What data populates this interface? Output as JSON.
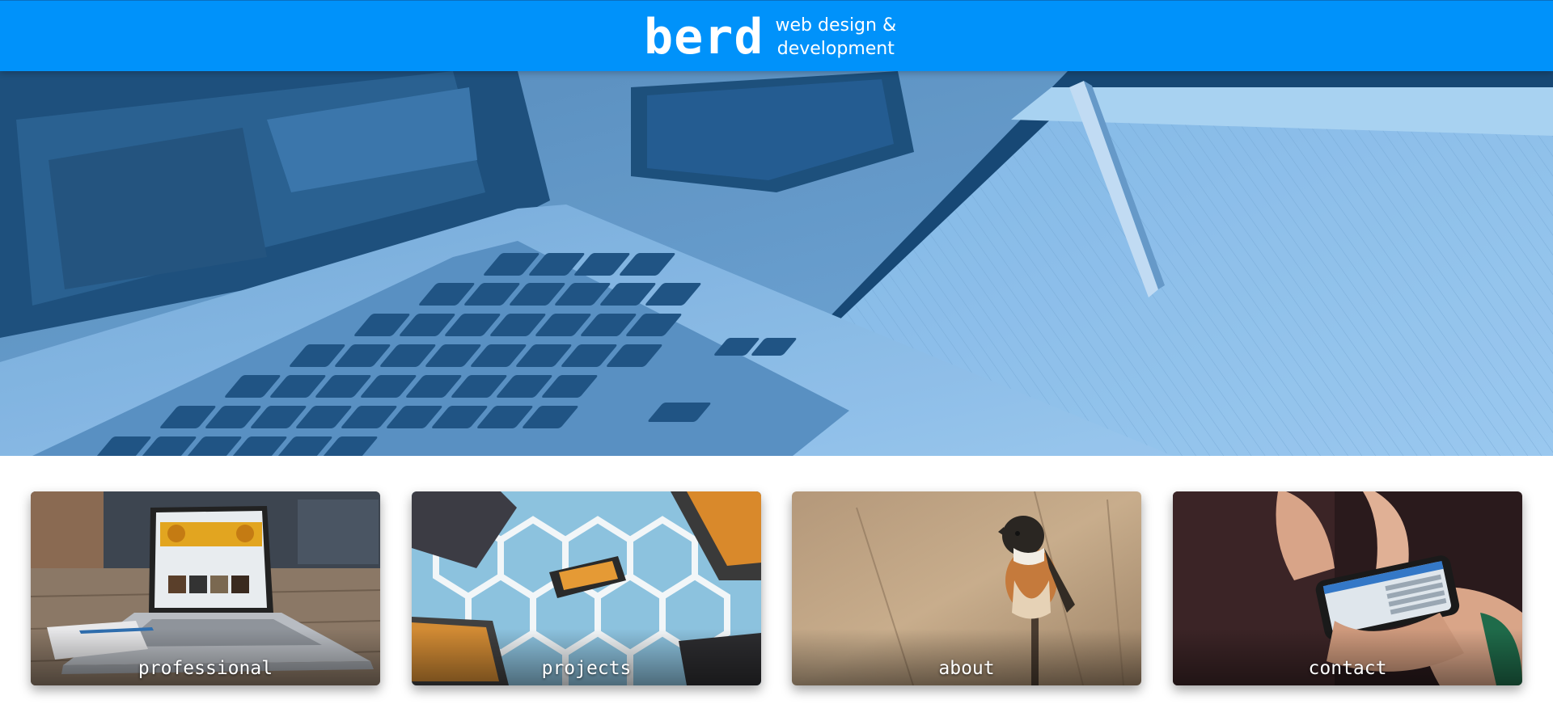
{
  "header": {
    "brand_name": "berd",
    "tagline": "web design &\ndevelopment",
    "background_color": "#0092fa"
  },
  "hero": {
    "image": "laptop-notebook-pen-photo",
    "tint_color": "#2e7fc2"
  },
  "cards": [
    {
      "label": "professional",
      "image": "laptop-on-wooden-desk-photo"
    },
    {
      "label": "projects",
      "image": "microchips-on-hexagon-pattern-photo"
    },
    {
      "label": "about",
      "image": "stonechat-bird-on-branch-photo"
    },
    {
      "label": "contact",
      "image": "hands-holding-smartphone-photo"
    }
  ]
}
